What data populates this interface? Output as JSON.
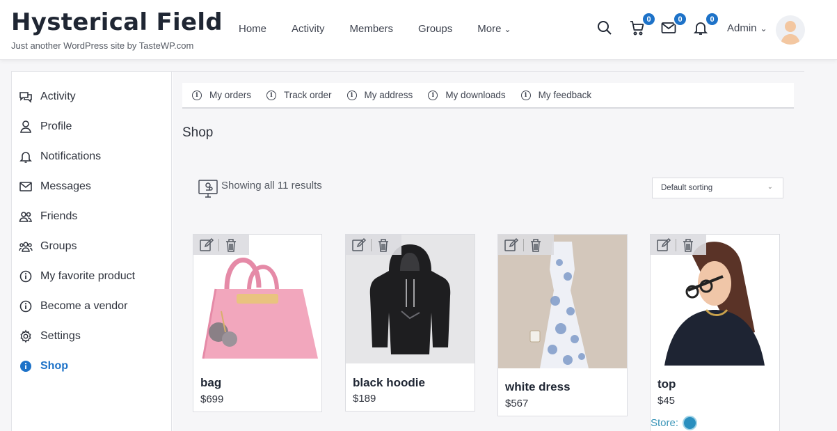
{
  "site": {
    "title": "Hysterical Field",
    "tagline": "Just another WordPress site by TasteWP.com"
  },
  "nav": {
    "items": [
      "Home",
      "Activity",
      "Members",
      "Groups",
      "More"
    ]
  },
  "header": {
    "search_icon": "search-icon",
    "cart_count": "0",
    "messages_count": "0",
    "notifications_count": "0",
    "user_label": "Admin"
  },
  "sidebar": {
    "items": [
      {
        "label": "Activity",
        "icon": "chat-icon"
      },
      {
        "label": "Profile",
        "icon": "user-icon"
      },
      {
        "label": "Notifications",
        "icon": "bell-icon"
      },
      {
        "label": "Messages",
        "icon": "mail-icon"
      },
      {
        "label": "Friends",
        "icon": "friends-icon"
      },
      {
        "label": "Groups",
        "icon": "groups-icon"
      },
      {
        "label": "My favorite product",
        "icon": "info-icon"
      },
      {
        "label": "Become a vendor",
        "icon": "info-icon"
      },
      {
        "label": "Settings",
        "icon": "gear-icon"
      },
      {
        "label": "Shop",
        "icon": "info-icon",
        "active": true
      }
    ]
  },
  "subtabs": [
    "My orders",
    "Track order",
    "My address",
    "My downloads",
    "My feedback"
  ],
  "page": {
    "heading": "Shop",
    "results": "Showing all 11 results",
    "sorting": "Default sorting"
  },
  "products": [
    {
      "name": "bag",
      "price": "$699"
    },
    {
      "name": "black hoodie",
      "price": "$189"
    },
    {
      "name": "white dress",
      "price": "$567"
    },
    {
      "name": "top",
      "price": "$45"
    }
  ],
  "store": {
    "label": "Store:"
  },
  "colors": {
    "accent": "#1d72c8",
    "store_link": "#3a95b8"
  }
}
